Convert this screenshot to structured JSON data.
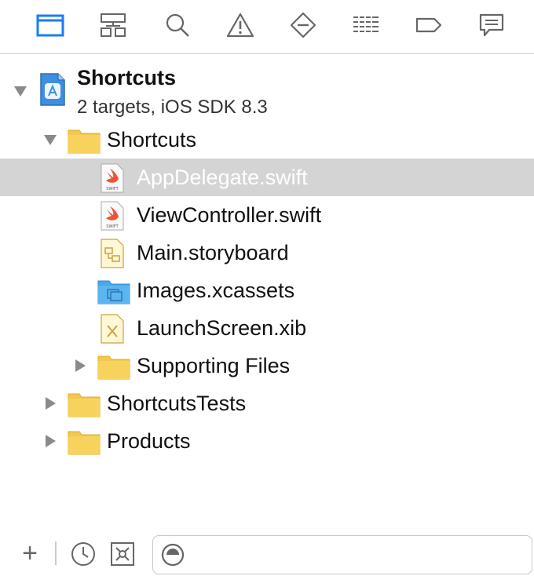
{
  "toolbar": {
    "icons": [
      "folder-icon",
      "hierarchy-icon",
      "search-icon",
      "warning-icon",
      "test-diamond-icon",
      "debug-list-icon",
      "breakpoint-tag-icon",
      "report-bubble-icon"
    ],
    "accent": "#1a7cf5"
  },
  "project": {
    "name": "Shortcuts",
    "subtitle": "2 targets, iOS SDK 8.3"
  },
  "tree": {
    "group_shortcuts": "Shortcuts",
    "files": [
      {
        "label": "AppDelegate.swift",
        "icon": "swift-file-icon",
        "selected": true
      },
      {
        "label": "ViewController.swift",
        "icon": "swift-file-icon",
        "selected": false
      },
      {
        "label": "Main.storyboard",
        "icon": "storyboard-file-icon",
        "selected": false
      },
      {
        "label": "Images.xcassets",
        "icon": "asset-catalog-icon",
        "selected": false
      },
      {
        "label": "LaunchScreen.xib",
        "icon": "xib-file-icon",
        "selected": false
      }
    ],
    "supporting_files": "Supporting Files",
    "tests_group": "ShortcutsTests",
    "products_group": "Products"
  },
  "bottom": {
    "add_label": "+",
    "filter_placeholder": ""
  }
}
